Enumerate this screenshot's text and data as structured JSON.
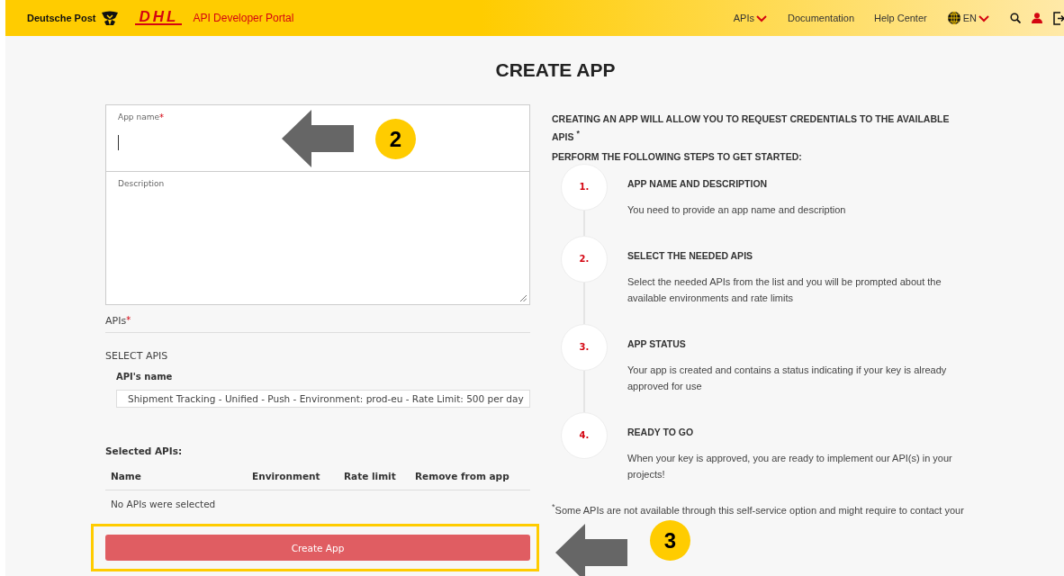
{
  "header": {
    "brand_post": "Deutsche Post",
    "brand_dhl": "DHL",
    "portal": "API Developer Portal",
    "nav": [
      {
        "label": "APIs",
        "dropdown": true
      },
      {
        "label": "Documentation",
        "dropdown": false
      },
      {
        "label": "Help Center",
        "dropdown": false
      }
    ],
    "language": "EN"
  },
  "title": "CREATE APP",
  "form": {
    "app_name_label": "App name",
    "app_name_mark": "*",
    "description_label": "Description",
    "apis_label": "APIs",
    "apis_mark": "*",
    "select_heading": "SELECT APIS",
    "api_name_label": "API's name",
    "api_value": "Shipment Tracking - Unified - Push - Environment: prod-eu - Rate Limit: 500 per day",
    "selected_heading": "Selected APIs:",
    "columns": [
      "Name",
      "Environment",
      "Rate limit",
      "Remove from app"
    ],
    "empty_text": "No APIs were selected",
    "submit": "Create App"
  },
  "info": {
    "intro": "CREATING AN APP WILL ALLOW YOU TO REQUEST CREDENTIALS TO THE AVAILABLE APIS $^{*}$",
    "steps_heading": "PERFORM THE FOLLOWING STEPS TO GET STARTED:",
    "steps": [
      {
        "number": "1.",
        "title": "APP NAME AND DESCRIPTION",
        "text": "You need to provide an app name and description"
      },
      {
        "number": "2.",
        "title": "SELECT THE NEEDED APIS",
        "text": "Select the needed APIs from the list and you will be prompted about the available environments and rate limits"
      },
      {
        "number": "3.",
        "title": "APP STATUS",
        "text": "Your app is created and contains a status indicating if your key is already approved for use"
      },
      {
        "number": "4.",
        "title": "READY TO GO",
        "text": "When your key is approved, you are ready to implement our API(s) in your projects!"
      }
    ],
    "footnote": "$^{*}$Some APIs are not available through this self-service option and might require to contact your"
  },
  "callouts": [
    {
      "number": "2"
    },
    {
      "number": "3"
    }
  ]
}
